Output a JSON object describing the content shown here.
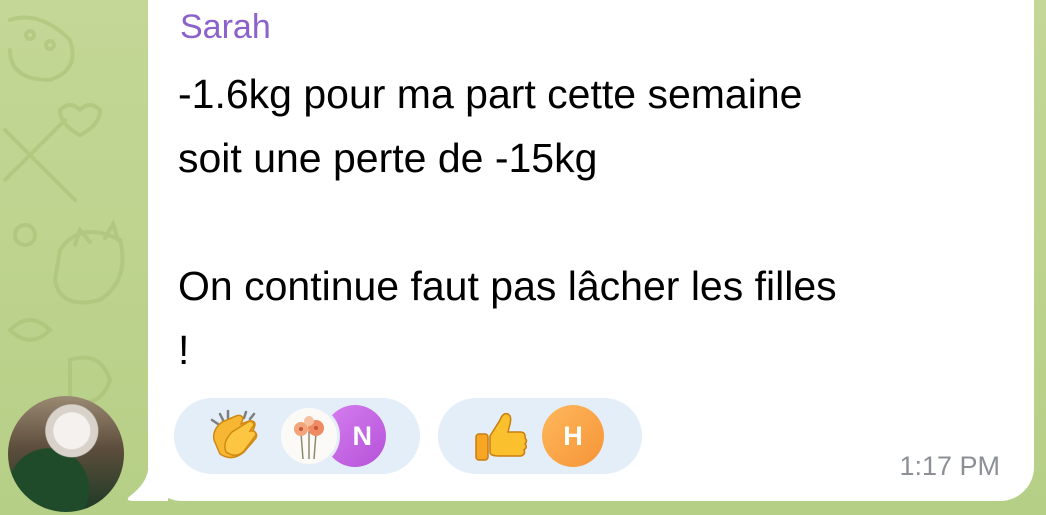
{
  "message": {
    "sender": "Sarah",
    "lines": [
      "-1.6kg pour ma part cette semaine",
      "soit une perte de -15kg",
      "",
      "On continue faut pas lâcher les filles",
      "!"
    ],
    "time": "1:17 PM"
  },
  "reactions": [
    {
      "emoji": "clapping-hands-icon",
      "users": [
        "flower-avatar",
        "N"
      ]
    },
    {
      "emoji": "thumbs-up-icon",
      "users": [
        "H"
      ]
    }
  ],
  "colors": {
    "sender": "#8b62cc",
    "chat_background": "#b9d08a",
    "reaction_pill": "#e4eef9",
    "time": "#8c8f94"
  }
}
